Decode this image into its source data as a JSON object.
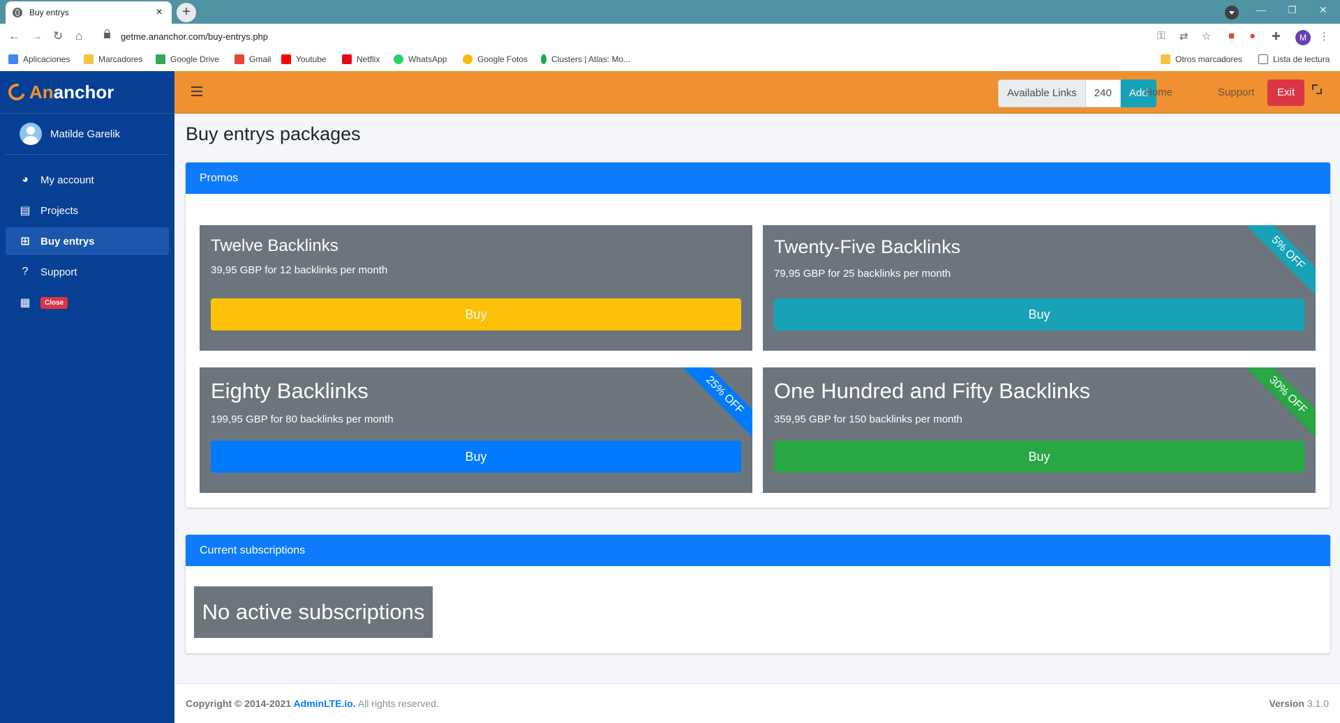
{
  "browser": {
    "tab_title": "Buy entrys",
    "tab_close": "×",
    "new_tab": "+",
    "url": "getme.ananchor.com/buy-entrys.php",
    "profile_initial": "M",
    "bookmarks": [
      "Aplicaciones",
      "Marcadores",
      "Google Drive",
      "Gmail",
      "Youtube",
      "Netflix",
      "WhatsApp",
      "Google Fotos",
      "Clusters | Atlas: Mo..."
    ],
    "other_bookmarks": "Otros marcadores",
    "reading_list": "Lista de lectura"
  },
  "brand": {
    "part1": "An",
    "part2": "anchor"
  },
  "user": {
    "name": "Matilde Garelik"
  },
  "sidebar": {
    "items": [
      {
        "label": "My account",
        "icon": "chart-pie-icon"
      },
      {
        "label": "Projects",
        "icon": "book-icon"
      },
      {
        "label": "Buy entrys",
        "icon": "plus-square-icon"
      },
      {
        "label": "Support",
        "icon": "question-icon"
      }
    ],
    "close_badge": "Close"
  },
  "navbar": {
    "available_links_label": "Available Links",
    "available_links_count": "240",
    "add_label": "Add",
    "home_label": "Home",
    "support_label": "Support",
    "exit_label": "Exit"
  },
  "page": {
    "title": "Buy entrys packages"
  },
  "promos": {
    "header": "Promos",
    "packages": [
      {
        "title": "Twelve Backlinks",
        "desc": "39,95 GBP for 12 backlinks per month",
        "button": "Buy",
        "ribbon": "",
        "button_color": "#ffc107"
      },
      {
        "title": "Twenty-Five Backlinks",
        "desc": "79,95 GBP for 25 backlinks per month",
        "button": "Buy",
        "ribbon": "5% OFF",
        "button_color": "#17a2b8"
      },
      {
        "title": "Eighty Backlinks",
        "desc": "199,95 GBP for 80 backlinks per month",
        "button": "Buy",
        "ribbon": "25% OFF",
        "button_color": "#007bff"
      },
      {
        "title": "One Hundred and Fifty Backlinks",
        "desc": "359,95 GBP for 150 backlinks per month",
        "button": "Buy",
        "ribbon": "30% OFF",
        "button_color": "#28a745"
      }
    ]
  },
  "subscriptions": {
    "header": "Current subscriptions",
    "empty_text": "No active subscriptions"
  },
  "footer": {
    "copyright_prefix": "Copyright © 2014-2021 ",
    "link": "AdminLTE.io.",
    "suffix": " All rights reserved.",
    "version_label": "Version",
    "version": " 3.1.0"
  }
}
